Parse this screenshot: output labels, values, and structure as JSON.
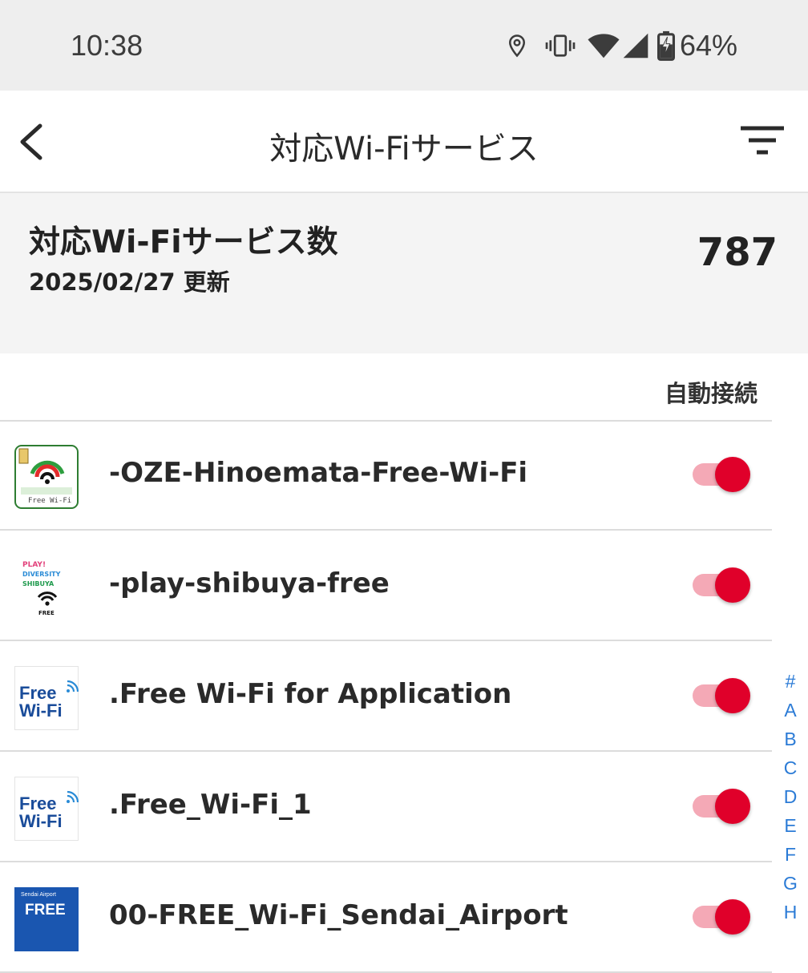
{
  "status_bar": {
    "time": "10:38",
    "battery_text": "64%",
    "icons": [
      "location-icon",
      "vibrate-icon",
      "wifi-icon",
      "cell-signal-icon",
      "battery-charging-icon"
    ]
  },
  "app_bar": {
    "title": "対応Wi-Fiサービス",
    "back_icon": "chevron-left-icon",
    "filter_icon": "filter-icon"
  },
  "summary": {
    "title": "対応Wi-Fiサービス数",
    "updated": "2025/02/27 更新",
    "count": "787"
  },
  "list_header": {
    "auto_connect": "自動接続"
  },
  "items": [
    {
      "name": "-OZE-Hinoemata-Free-Wi-Fi",
      "icon": "oze-hinoemata-logo-icon",
      "auto_connect": true
    },
    {
      "name": "-play-shibuya-free",
      "icon": "play-shibuya-logo-icon",
      "auto_connect": true
    },
    {
      "name": ".Free Wi-Fi for Application",
      "icon": "free-wifi-logo-icon",
      "auto_connect": true
    },
    {
      "name": ".Free_Wi-Fi_1",
      "icon": "free-wifi-logo-icon",
      "auto_connect": true
    },
    {
      "name": "00-FREE_Wi-Fi_Sendai_Airport",
      "icon": "sendai-airport-logo-icon",
      "auto_connect": true
    }
  ],
  "logo_text": {
    "free": "Free",
    "wifi": "Wi-Fi",
    "oze_caption": "Free Wi-Fi",
    "play_line1": "PLAY!",
    "play_line2": "DIVERSITY",
    "play_line3": "SHIBUYA",
    "play_line4": "FREE",
    "sendai_top": "Sendai Airport",
    "sendai_free": "FREE"
  },
  "index": [
    "#",
    "A",
    "B",
    "C",
    "D",
    "E",
    "F",
    "G",
    "H"
  ],
  "colors": {
    "accent_red": "#e0002a",
    "toggle_track": "#f4a9b6",
    "index_blue": "#2b7bd6",
    "logo_blue": "#1a4c9a"
  }
}
